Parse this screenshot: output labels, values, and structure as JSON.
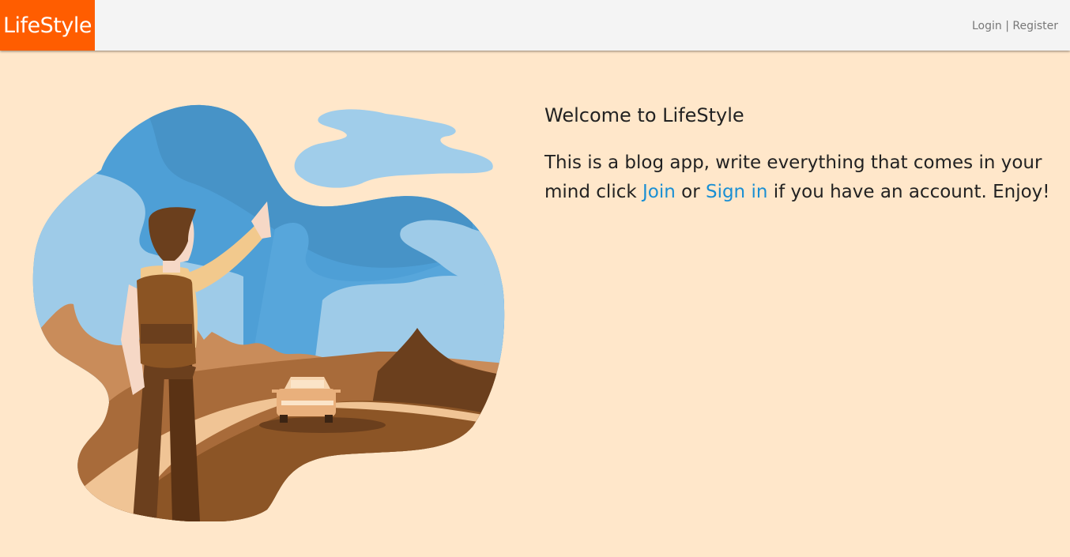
{
  "navbar": {
    "brand": "LifeStyle",
    "login_label": "Login",
    "separator": "|",
    "register_label": "Register"
  },
  "hero": {
    "title": "Welcome to LifeStyle",
    "text_before": "This is a blog app, write everything that comes in your mind click ",
    "join_label": "Join",
    "text_middle": " or ",
    "signin_label": "Sign in",
    "text_after": " if you have an account. Enjoy!"
  },
  "colors": {
    "brand_bg": "#ff5d00",
    "page_bg": "#ffe7ca",
    "link": "#1a8fd3"
  },
  "illustration": "hitchhiker-illustration"
}
